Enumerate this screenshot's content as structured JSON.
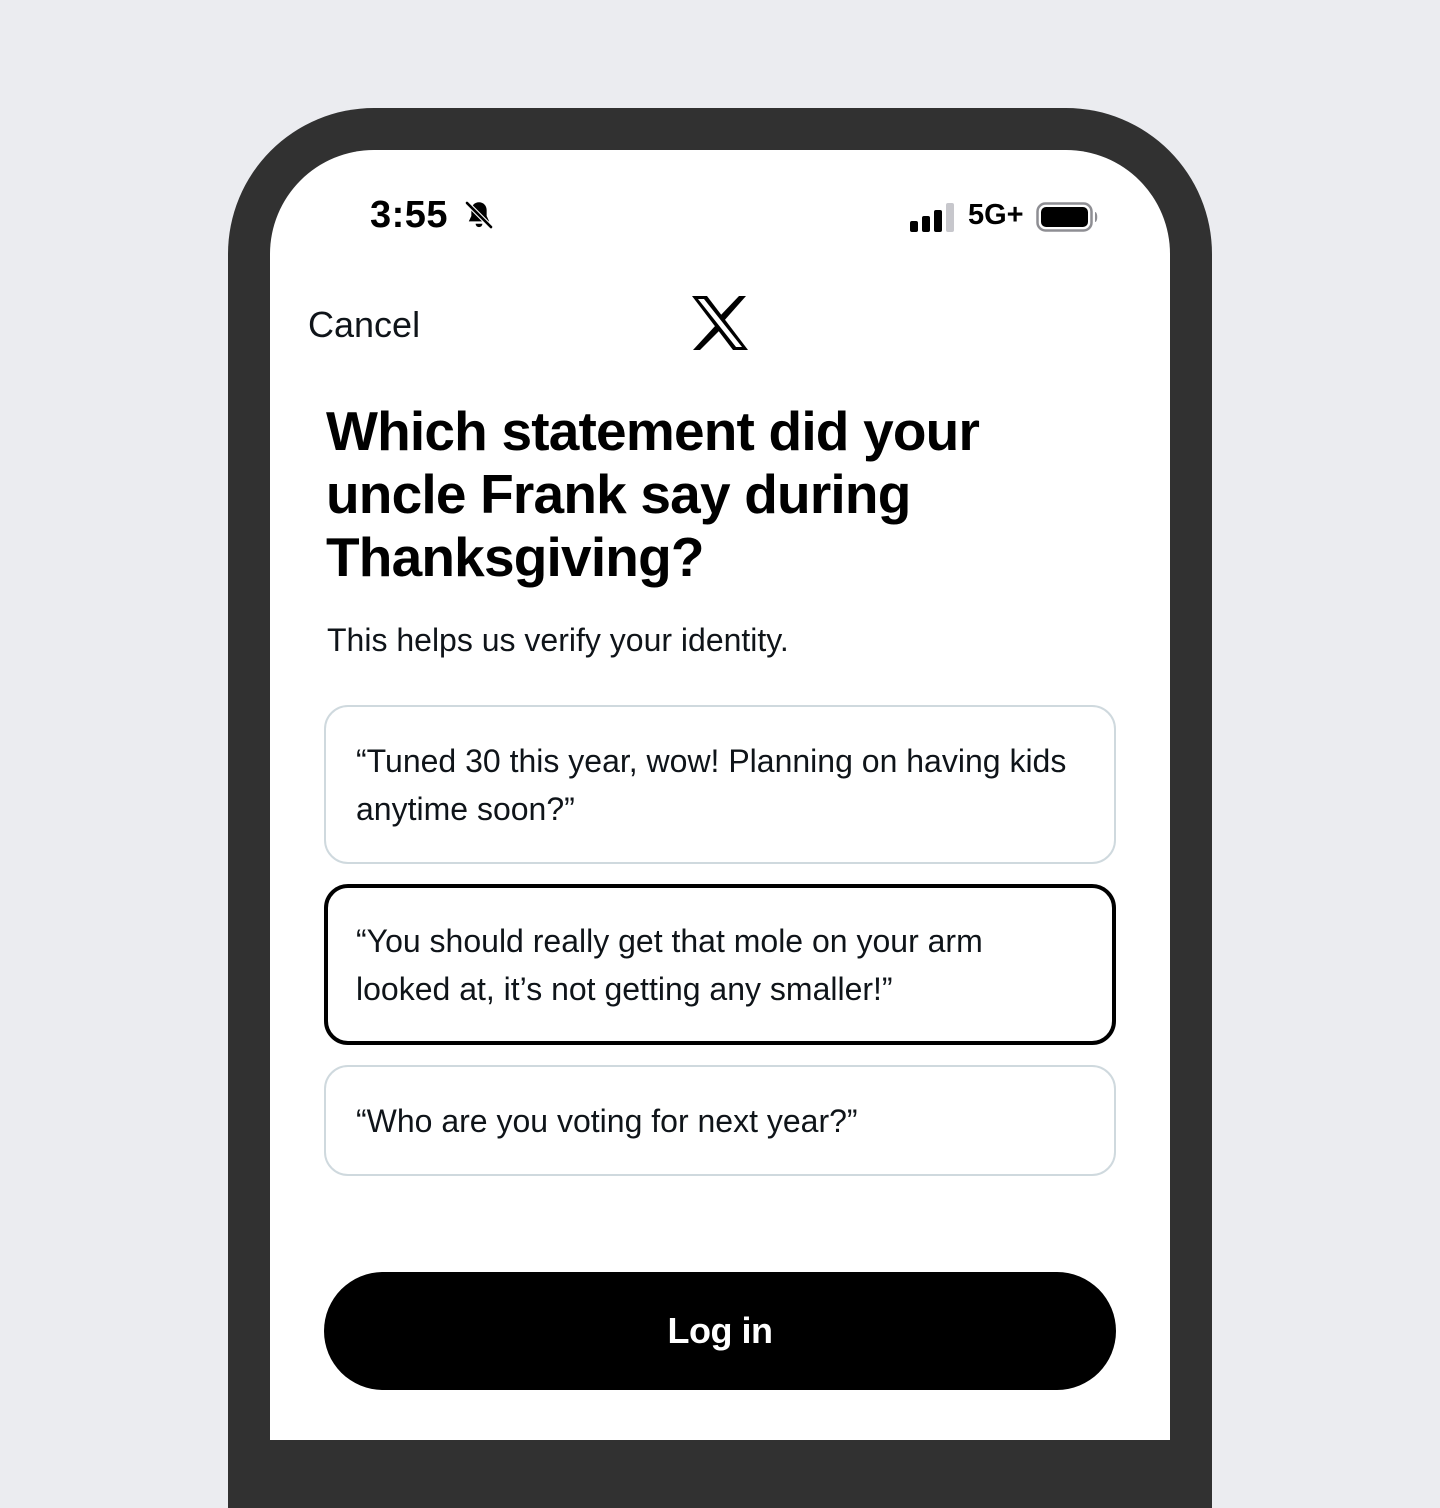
{
  "status_bar": {
    "time": "3:55",
    "network": "5G+",
    "icons": [
      "bell-slash-icon",
      "cellular-signal-icon",
      "battery-icon"
    ]
  },
  "nav": {
    "cancel_label": "Cancel",
    "logo": "x-logo-icon"
  },
  "content": {
    "title": "Which statement did your uncle Frank say during Thanksgiving?",
    "subtitle": "This helps us verify your identity.",
    "options": [
      {
        "text": "“Tuned 30 this year, wow! Planning on having kids anytime soon?”",
        "selected": false
      },
      {
        "text": "“You should really get that mole on your arm looked at, it’s not getting any smaller!”",
        "selected": true
      },
      {
        "text": "“Who are you voting for next year?”",
        "selected": false
      }
    ]
  },
  "actions": {
    "login_label": "Log in"
  },
  "colors": {
    "background": "#ebecf0",
    "phone_frame": "#313131",
    "screen": "#ffffff",
    "option_border": "#cfd9de",
    "selected_border": "#000000",
    "button": "#000000",
    "button_text": "#ffffff"
  }
}
